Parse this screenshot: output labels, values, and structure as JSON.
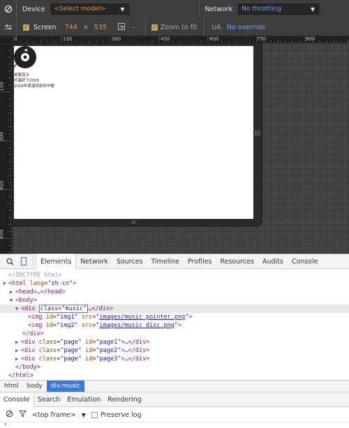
{
  "emulation": {
    "device_label": "Device",
    "device_select": "<Select model>",
    "network_label": "Network",
    "network_select": "No throttling",
    "screen_label": "Screen",
    "screen_width": "744",
    "screen_x": "×",
    "screen_height": "535",
    "dash": "–",
    "zoom_label": "Zoom to fit",
    "ua_label": "UA",
    "ua_value": "No override"
  },
  "rulers": {
    "top": [
      "0",
      "150",
      "300",
      "450",
      "600",
      "750",
      "900"
    ],
    "left": [
      "150",
      "300",
      "450",
      "600"
    ]
  },
  "emulated_page": {
    "lines": [
      "桌面显示",
      "开幕好了2016",
      "2016年首演同桥年华歌"
    ]
  },
  "devtools": {
    "tabs": [
      "Elements",
      "Network",
      "Sources",
      "Timeline",
      "Profiles",
      "Resources",
      "Audits",
      "Console"
    ],
    "active_tab": "Elements"
  },
  "dom_tree": {
    "doctype": "<!DOCTYPE html>",
    "html_open_tag": "html",
    "html_attr_name": "lang",
    "html_attr_value": "\"zh-cn\"",
    "head": "<head>…</head>",
    "body_open": "<body>",
    "div_tag": "div",
    "div_attr_edit": "class=\"music\"",
    "div_close": "…</div>",
    "img1_src": "images/music_pointer.png",
    "img1_id": "\"img1\"",
    "img2_src": "images/music_disc.png",
    "img2_id": "\"img2\"",
    "div_end": "</div>",
    "page_class": "\"page\"",
    "page_ids": [
      "\"page1\"",
      "\"page2\"",
      "\"page3\""
    ],
    "page_tail": ">…</div>",
    "body_close": "</body>",
    "html_close": "</html>"
  },
  "breadcrumbs": [
    "html",
    "body",
    "div.music"
  ],
  "drawer": {
    "tabs": [
      "Console",
      "Search",
      "Emulation",
      "Rendering"
    ],
    "context": "<top frame>",
    "preserve_log": "Preserve log"
  }
}
